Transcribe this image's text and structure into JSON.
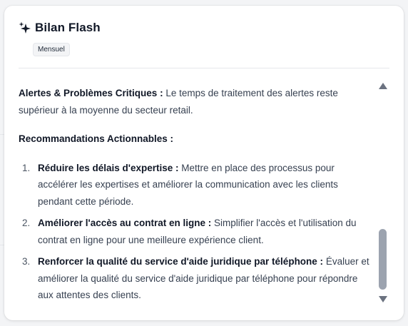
{
  "header": {
    "icon": "sparkle-icon",
    "title": "Bilan Flash",
    "badge": "Mensuel"
  },
  "content": {
    "alert": {
      "label": "Alertes & Problèmes Critiques :",
      "text": " Le temps de traitement des alertes reste supérieur à la moyenne du secteur retail."
    },
    "reco_heading": "Recommandations Actionnables :",
    "recommendations": [
      {
        "num": "1.",
        "label": "Réduire les délais d'expertise :",
        "text": " Mettre en place des processus pour accélérer les expertises et améliorer la communication avec les clients pendant cette période."
      },
      {
        "num": "2.",
        "label": "Améliorer l'accès au contrat en ligne :",
        "text": " Simplifier l'accès et l'utilisation du contrat en ligne pour une meilleure expérience client."
      },
      {
        "num": "3.",
        "label": "Renforcer la qualité du service d'aide juridique par téléphone :",
        "text": " Évaluer et améliorer la qualité du service d'aide juridique par téléphone pour répondre aux attentes des clients."
      }
    ]
  },
  "colors": {
    "title": "#111827",
    "body_text": "#374151",
    "scroll_thumb": "#9ca3af"
  }
}
